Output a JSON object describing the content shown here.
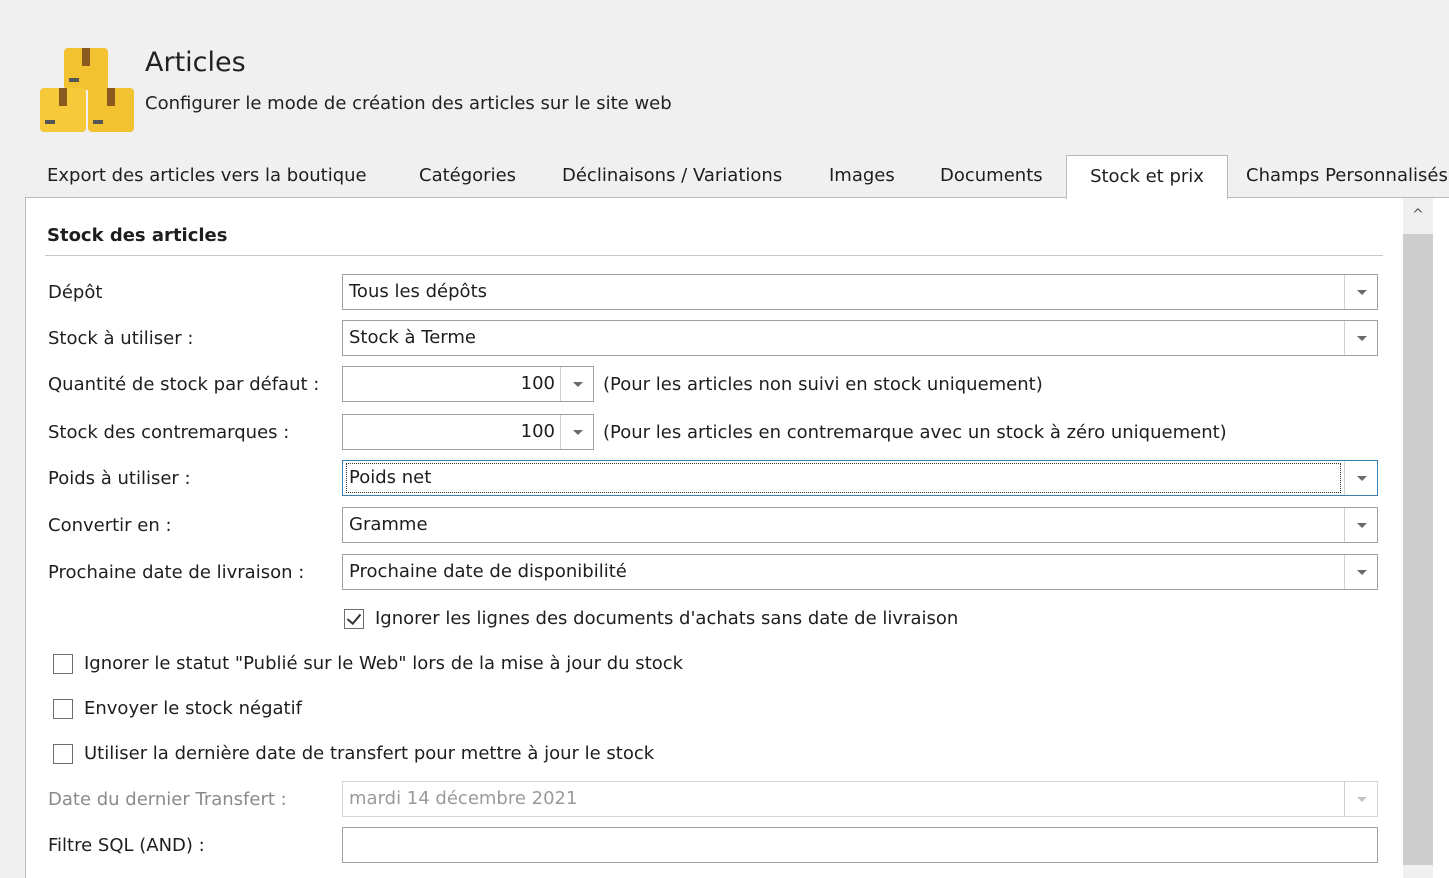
{
  "header": {
    "icon": "boxes-icon",
    "title": "Articles",
    "subtitle": "Configurer le mode de création des articles sur le site web"
  },
  "tabs": [
    {
      "label": "Export des articles vers la boutique",
      "active": false
    },
    {
      "label": "Catégories",
      "active": false
    },
    {
      "label": "Déclinaisons / Variations",
      "active": false
    },
    {
      "label": "Images",
      "active": false
    },
    {
      "label": "Documents",
      "active": false
    },
    {
      "label": "Stock et prix",
      "active": true
    },
    {
      "label": "Champs Personnalisés",
      "active": false
    }
  ],
  "section": {
    "title": "Stock des articles"
  },
  "form": {
    "depot": {
      "label": "Dépôt",
      "value": "Tous les dépôts"
    },
    "stock_a_utiliser": {
      "label": "Stock à utiliser :",
      "value": "Stock à Terme"
    },
    "quantite_defaut": {
      "label": "Quantité de stock par défaut :",
      "value": "100",
      "hint": "(Pour les articles non suivi en stock uniquement)"
    },
    "stock_contremarques": {
      "label": "Stock des contremarques :",
      "value": "100",
      "hint": "(Pour les articles en contremarque avec un stock à zéro uniquement)"
    },
    "poids": {
      "label": "Poids à utiliser :",
      "value": "Poids net"
    },
    "convertir": {
      "label": "Convertir en :",
      "value": "Gramme"
    },
    "prochaine_date": {
      "label": "Prochaine date de livraison :",
      "value": "Prochaine date de disponibilité"
    },
    "ignorer_lignes": {
      "label": "Ignorer les lignes des documents d'achats sans date de livraison",
      "checked": true
    },
    "ignorer_statut": {
      "label": "Ignorer le statut \"Publié sur le Web\" lors de la mise à jour du stock",
      "checked": false
    },
    "stock_negatif": {
      "label": "Envoyer le stock négatif",
      "checked": false
    },
    "derniere_date": {
      "label": "Utiliser la dernière date de transfert pour mettre à jour le stock",
      "checked": false
    },
    "date_transfert": {
      "label": "Date du dernier Transfert :",
      "value": "mardi 14 décembre 2021",
      "enabled": false
    },
    "filtre_sql": {
      "label": "Filtre SQL (AND) :",
      "value": ""
    }
  },
  "colors": {
    "accent": "#3c7fb1",
    "icon_box": "#f2c230",
    "panel_bg": "#ffffff",
    "window_bg": "#f0f0f0"
  }
}
